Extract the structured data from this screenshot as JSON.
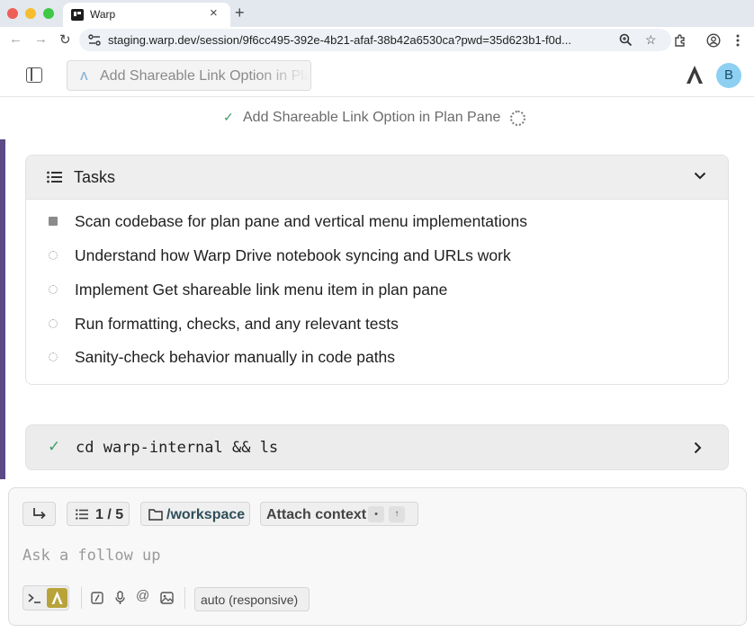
{
  "browser": {
    "tab_title": "Warp",
    "tab_close": "×",
    "new_tab": "+",
    "back": "←",
    "forward": "→",
    "reload": "↻",
    "url": "staging.warp.dev/session/9f6cc495-392e-4b21-afaf-38b42a6530ca?pwd=35d623b1-f0d..."
  },
  "header": {
    "title_chip": "Add Shareable Link Option in Plan Pane",
    "avatar_initial": "B"
  },
  "status": {
    "text": "Add Shareable Link Option in Plan Pane",
    "check": "✓"
  },
  "tasks": {
    "title": "Tasks",
    "items": [
      {
        "label": "Scan codebase for plan pane and vertical menu implementations",
        "state": "in-progress"
      },
      {
        "label": "Understand how Warp Drive notebook syncing and URLs work",
        "state": "pending"
      },
      {
        "label": "Implement Get shareable link menu item in plan pane",
        "state": "pending"
      },
      {
        "label": "Run formatting, checks, and any relevant tests",
        "state": "pending"
      },
      {
        "label": "Sanity-check behavior manually in code paths",
        "state": "pending"
      }
    ]
  },
  "command": {
    "check": "✓",
    "text": "cd warp-internal && ls"
  },
  "composer": {
    "task_progress": "1 / 5",
    "directory": "/workspace",
    "attach_context": "Attach context",
    "attach_dot": "•",
    "attach_up": "↑",
    "input_placeholder": "Ask a follow up",
    "model": "auto (responsive)",
    "mention": "@"
  },
  "colors": {
    "success": "#3f9c68",
    "accent_bar": "#5b4a86",
    "avatar": "#8ed0f2",
    "agent_mode": "#b8a33a"
  }
}
